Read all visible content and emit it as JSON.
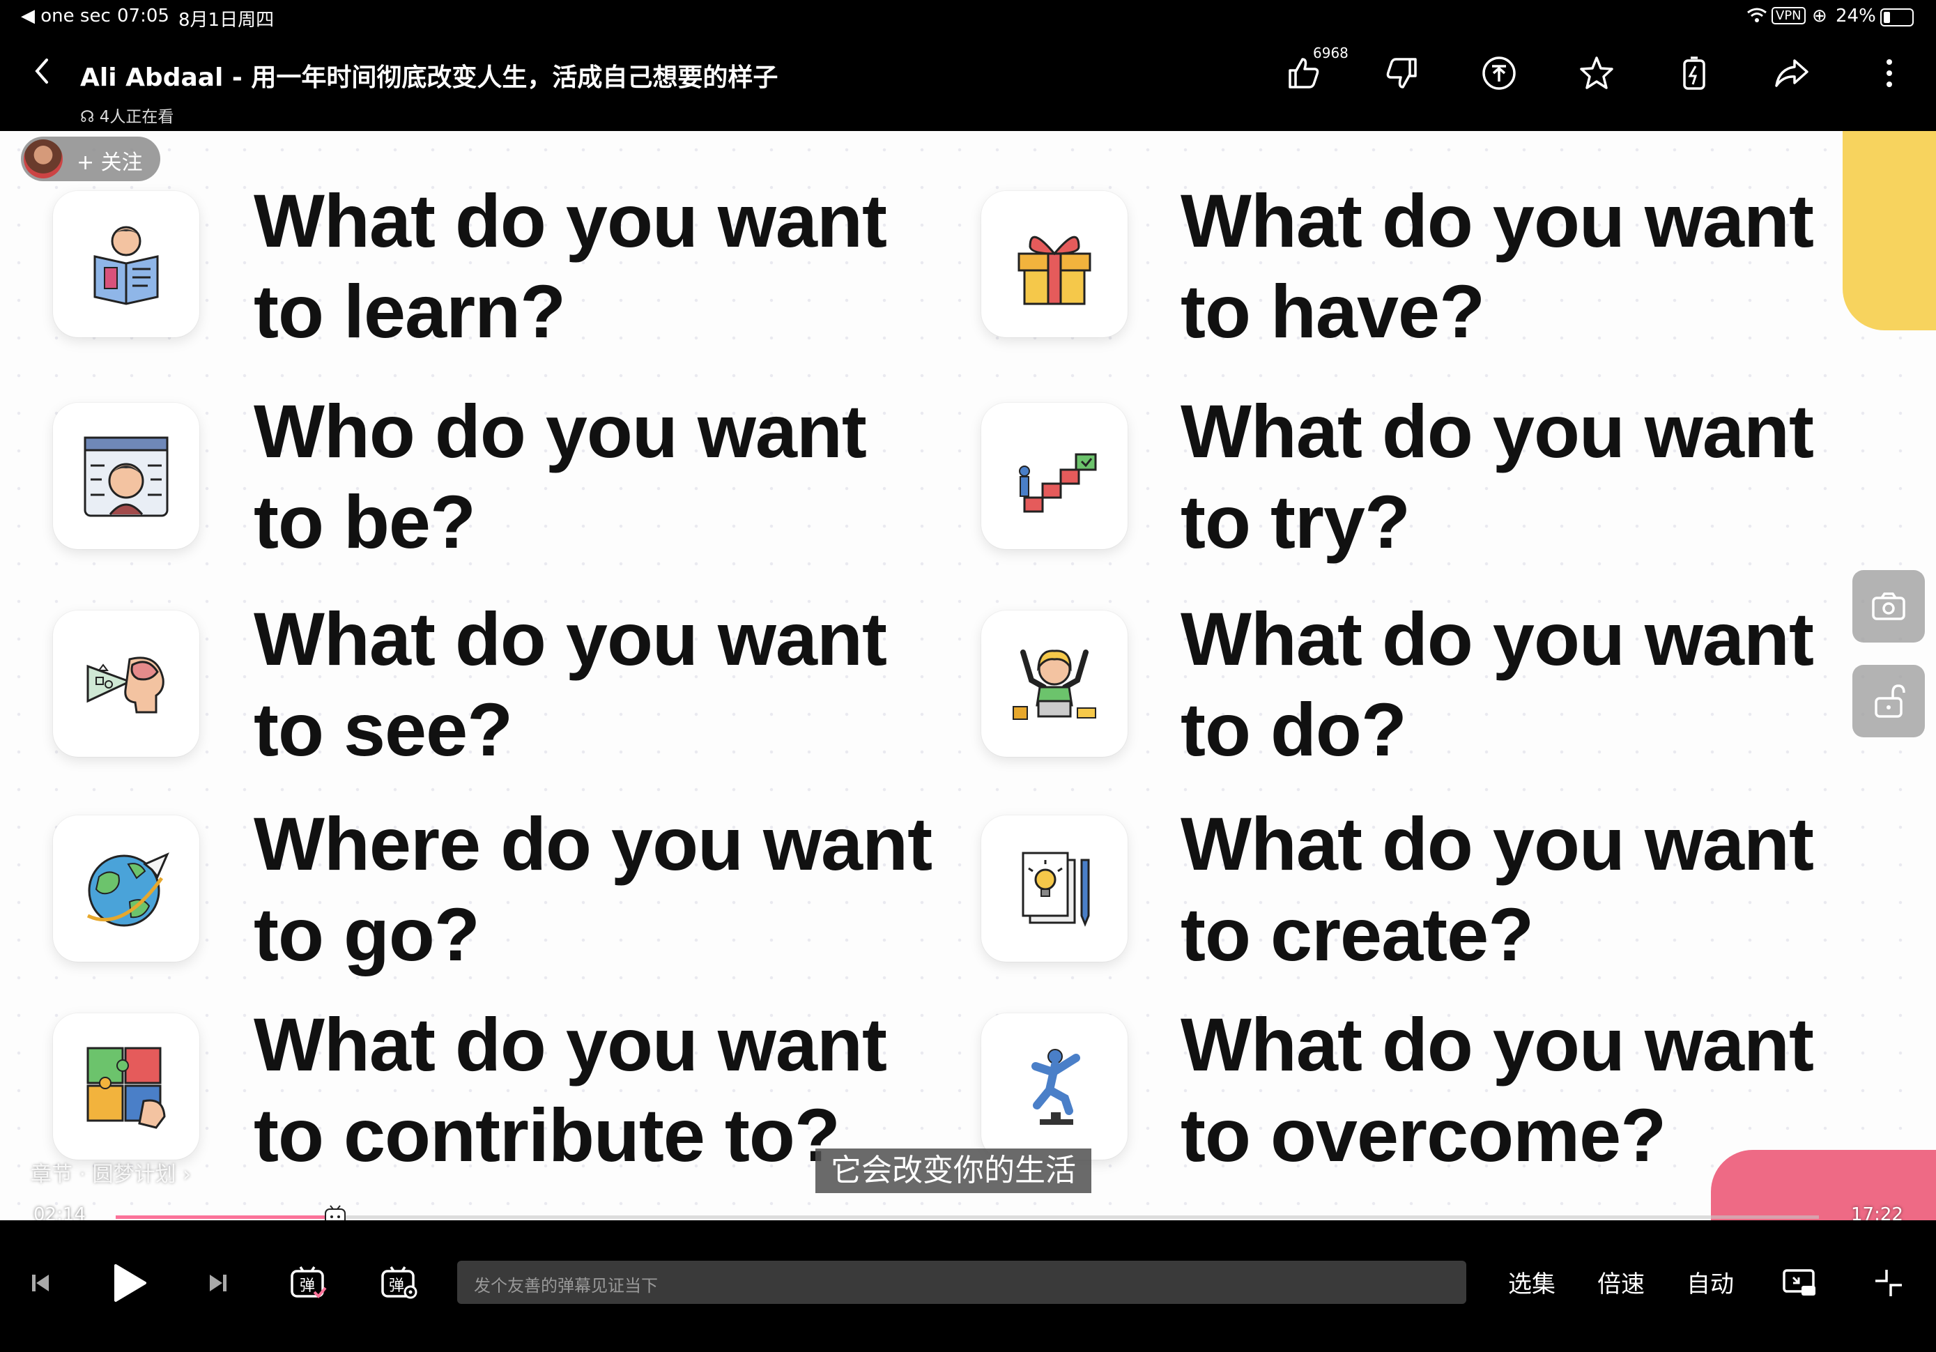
{
  "status_bar": {
    "back_app": "◀ one sec",
    "time": "07:05",
    "date": "8月1日周四",
    "vpn": "VPN",
    "battery": "24%"
  },
  "header": {
    "title": "Ali Abdaal - 用一年时间彻底改变人生，活成自己想要的样子",
    "viewers": "4人正在看",
    "like_count": "6968"
  },
  "video": {
    "follow_label": "+ 关注",
    "subtitle": "它会改变你的生活",
    "chapter": "章节 · 圆梦计划 ›",
    "current_time": "02:14",
    "total_time": "17:22",
    "progress": 0.129,
    "questions": [
      {
        "line1": "What do you want",
        "line2": "to learn?",
        "icon": "reading-person-icon"
      },
      {
        "line1": "Who do you want",
        "line2": "to be?",
        "icon": "person-circuit-icon"
      },
      {
        "line1": "What do you want",
        "line2": "to see?",
        "icon": "vision-head-icon"
      },
      {
        "line1": "Where do you want",
        "line2": "to go?",
        "icon": "globe-plane-icon"
      },
      {
        "line1": "What do you want",
        "line2": "to contribute to?",
        "icon": "puzzle-icon"
      },
      {
        "line1": "What do you want",
        "line2": "to have?",
        "icon": "gift-icon"
      },
      {
        "line1": "What do you want",
        "line2": "to try?",
        "icon": "stairs-icon"
      },
      {
        "line1": "What do you want",
        "line2": "to do?",
        "icon": "happy-worker-icon"
      },
      {
        "line1": "What do you want",
        "line2": "to create?",
        "icon": "idea-paper-icon"
      },
      {
        "line1": "What do you want",
        "line2": "to overcome?",
        "icon": "jumping-person-icon"
      }
    ]
  },
  "controls": {
    "danmaku_placeholder": "发个友善的弹幕见证当下",
    "episodes": "选集",
    "speed": "倍速",
    "auto": "自动"
  },
  "colors": {
    "accent_pink": "#fb7299",
    "yellow_tab": "#f7d35e",
    "pink_tab": "#ee6a85"
  }
}
